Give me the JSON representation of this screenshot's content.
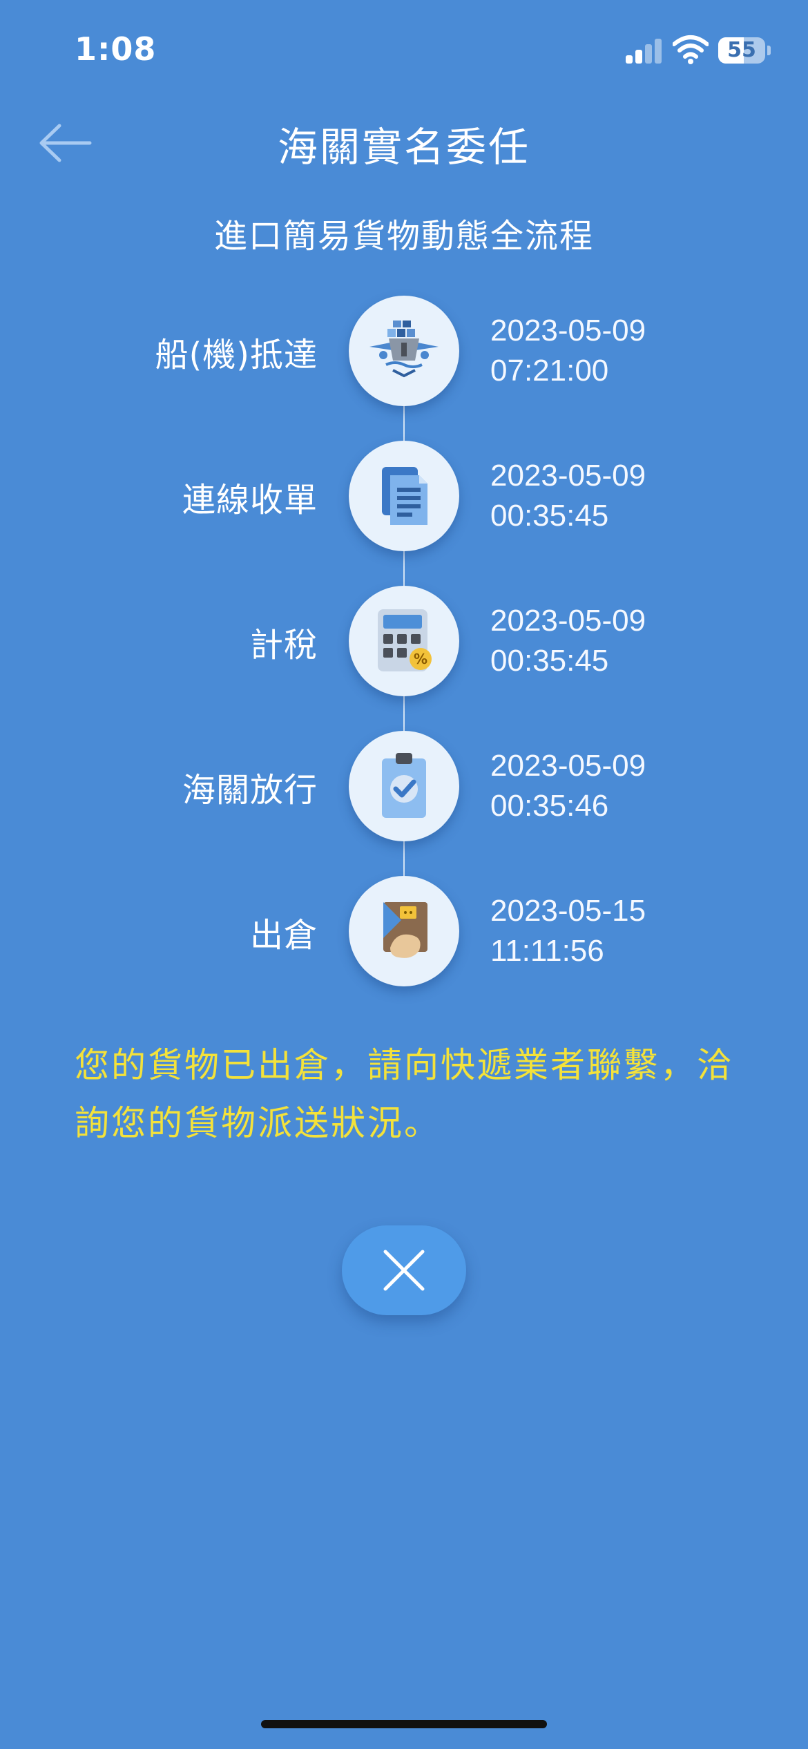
{
  "status_bar": {
    "time": "1:08",
    "battery": "55",
    "battery_level": 0.55,
    "icons": [
      "cellular-signal-icon",
      "wifi-icon",
      "battery-icon"
    ]
  },
  "header": {
    "back_icon": "arrow-left-icon",
    "title": "海關實名委任"
  },
  "subtitle": "進口簡易貨物動態全流程",
  "steps": [
    {
      "label": "船(機)抵達",
      "date": "2023-05-09",
      "time": "07:21:00",
      "icon": "ship-plane-icon"
    },
    {
      "label": "連線收單",
      "date": "2023-05-09",
      "time": "00:35:45",
      "icon": "documents-icon"
    },
    {
      "label": "計稅",
      "date": "2023-05-09",
      "time": "00:35:45",
      "icon": "calculator-icon"
    },
    {
      "label": "海關放行",
      "date": "2023-05-09",
      "time": "00:35:46",
      "icon": "clipboard-check-icon"
    },
    {
      "label": "出倉",
      "date": "2023-05-15",
      "time": "11:11:56",
      "icon": "package-pickup-icon"
    }
  ],
  "notice": "您的貨物已出倉，請向快遞業者聯繫，洽詢您的貨物派送狀況。",
  "close_button": {
    "icon": "close-icon"
  },
  "colors": {
    "background": "#4a8bd6",
    "notice_text": "#f4e23a",
    "close_button": "#4f9be8",
    "circle": "#e8f2fc"
  }
}
